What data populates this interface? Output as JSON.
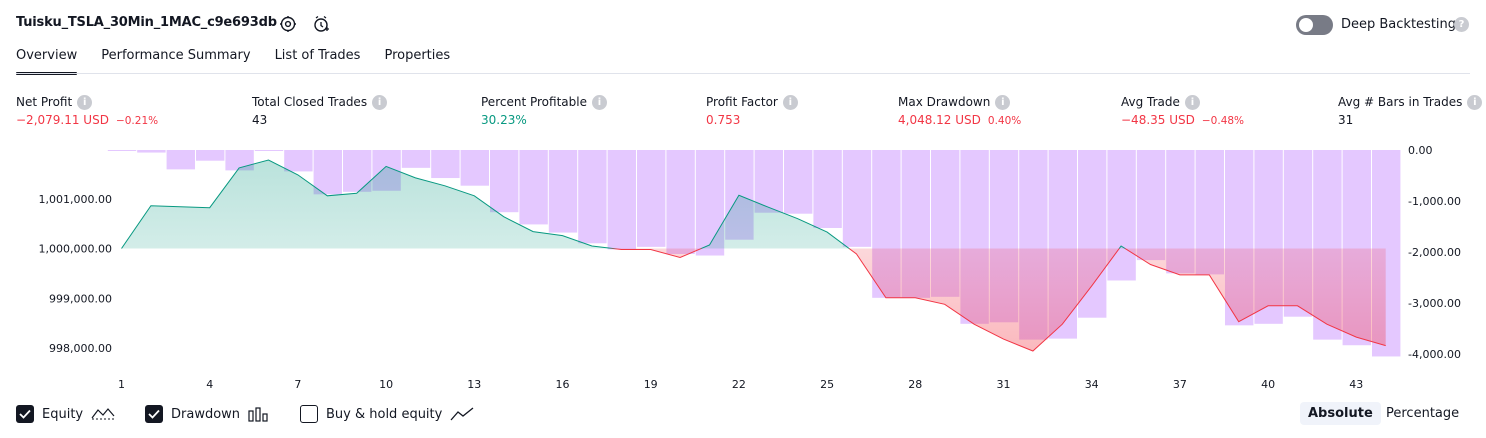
{
  "header": {
    "title": "Tuisku_TSLA_30Min_1MAC_c9e693db",
    "deep_backtesting_label": "Deep Backtesting",
    "deep_backtesting_on": false
  },
  "tabs": [
    {
      "label": "Overview",
      "active": true
    },
    {
      "label": "Performance Summary",
      "active": false
    },
    {
      "label": "List of Trades",
      "active": false
    },
    {
      "label": "Properties",
      "active": false
    }
  ],
  "metrics": [
    {
      "label": "Net Profit",
      "value": "−2,079.11 USD",
      "pct": "−0.21%",
      "color": "#f23645"
    },
    {
      "label": "Total Closed Trades",
      "value": "43",
      "pct": "",
      "color": "#131722"
    },
    {
      "label": "Percent Profitable",
      "value": "30.23%",
      "pct": "",
      "color": "#089981"
    },
    {
      "label": "Profit Factor",
      "value": "0.753",
      "pct": "",
      "color": "#f23645"
    },
    {
      "label": "Max Drawdown",
      "value": "4,048.12 USD",
      "pct": "0.40%",
      "color": "#f23645"
    },
    {
      "label": "Avg Trade",
      "value": "−48.35 USD",
      "pct": "−0.48%",
      "color": "#f23645"
    },
    {
      "label": "Avg # Bars in Trades",
      "value": "31",
      "pct": "",
      "color": "#131722"
    }
  ],
  "legend": {
    "equity_label": "Equity",
    "equity_checked": true,
    "drawdown_label": "Drawdown",
    "drawdown_checked": true,
    "buyhold_label": "Buy & hold equity",
    "buyhold_checked": false,
    "absolute_label": "Absolute",
    "percentage_label": "Percentage",
    "mode_selected": "Absolute"
  },
  "colors": {
    "equity_up": "#089981",
    "equity_down": "#f23645",
    "drawdown_bar": "#e1c2ff",
    "accent": "#131722"
  },
  "chart_data": {
    "type": "line",
    "x": [
      1,
      2,
      3,
      4,
      5,
      6,
      7,
      8,
      9,
      10,
      11,
      12,
      13,
      14,
      15,
      16,
      17,
      18,
      19,
      20,
      21,
      22,
      23,
      24,
      25,
      26,
      27,
      28,
      29,
      30,
      31,
      32,
      33,
      34,
      35,
      36,
      37,
      38,
      39,
      40,
      41,
      42,
      43,
      44
    ],
    "x_tick_labels": [
      "1",
      "4",
      "7",
      "10",
      "13",
      "16",
      "19",
      "22",
      "25",
      "28",
      "31",
      "34",
      "37",
      "40",
      "43"
    ],
    "series": [
      {
        "axis": "left",
        "values": [
          1000000,
          1000860,
          1000840,
          1000820,
          1001620,
          1001780,
          1001480,
          1001060,
          1001110,
          1001650,
          1001420,
          1001260,
          1001060,
          1000640,
          1000340,
          1000260,
          1000050,
          999980,
          999980,
          999820,
          1000070,
          1001070,
          1000830,
          1000600,
          1000330,
          999890,
          999010,
          999010,
          998880,
          998480,
          998180,
          997940,
          998480,
          999250,
          1000050,
          999680,
          999470,
          999470,
          998530,
          998850,
          998850,
          998480,
          998220,
          998050
        ]
      },
      {
        "axis": "right",
        "values": [
          0,
          -50,
          -380,
          -210,
          -400,
          0,
          -420,
          -870,
          -820,
          -800,
          -350,
          -550,
          -700,
          -1220,
          -1460,
          -1620,
          -1830,
          -1950,
          -1900,
          -2040,
          -2070,
          -1760,
          -1230,
          -1250,
          -1530,
          -1900,
          -2900,
          -2900,
          -2880,
          -3410,
          -3380,
          -3720,
          -3700,
          -3290,
          -2560,
          -2160,
          -2420,
          -2440,
          -3440,
          -3410,
          -3270,
          -3720,
          -3830,
          -4050
        ]
      }
    ],
    "y_left_ticks": [
      "1,001,000.00",
      "1,000,000.00",
      "999,000.00",
      "998,000.00"
    ],
    "y_right_ticks": [
      "0.00",
      "-1,000.00",
      "-2,000.00",
      "-3,000.00",
      "-4,000.00"
    ],
    "ylim_left": [
      997780,
      1001980
    ],
    "ylim_right": [
      -4100,
      0
    ],
    "baseline": 1000000,
    "grid": false
  }
}
